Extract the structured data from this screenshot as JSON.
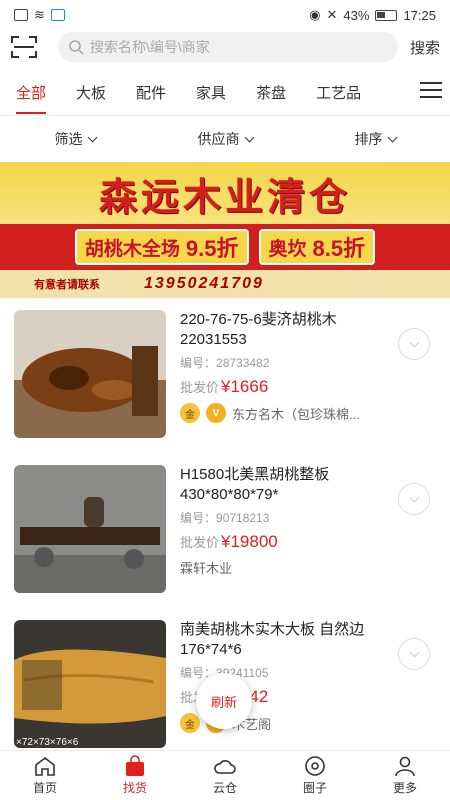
{
  "status": {
    "battery": "43%",
    "time": "17:25"
  },
  "search": {
    "placeholder": "搜索名称\\编号\\商家",
    "button": "搜索"
  },
  "categories": [
    "全部",
    "大板",
    "配件",
    "家具",
    "茶盘",
    "工艺品"
  ],
  "filters": [
    "筛选",
    "供应商",
    "排序"
  ],
  "banner": {
    "title": "森远木业清仓",
    "left_label": "胡桃木全场",
    "left_discount": "9.5折",
    "right_label": "奥坎",
    "right_discount": "8.5折",
    "contact": "有意者请联系",
    "phone": "13950241709"
  },
  "products": [
    {
      "name": "220-76-75-6斐济胡桃木22031553",
      "code_label": "编号：",
      "code": "28733482",
      "price_label": "批发价",
      "price": "¥1666",
      "gold": "金",
      "verified": "V",
      "shop": "东方名木（包珍珠棉..."
    },
    {
      "name": "H1580北美黑胡桃整板430*80*80*79*",
      "code_label": "编号：",
      "code": "90718213",
      "price_label": "批发价",
      "price": "¥19800",
      "shop": "霖轩木业"
    },
    {
      "name": "南美胡桃木实木大板 自然边176*74*6",
      "code_label": "编号：",
      "code": "39241105",
      "price_label": "批发价",
      "price": "¥1042",
      "gold": "金",
      "verified": "V",
      "shop": "木艺阁",
      "image_caption": "×72×73×76×6"
    }
  ],
  "refresh_label": "刷新",
  "nav": [
    "首页",
    "找货",
    "云仓",
    "圈子",
    "更多"
  ],
  "colors": {
    "accent": "#e21f1f"
  }
}
